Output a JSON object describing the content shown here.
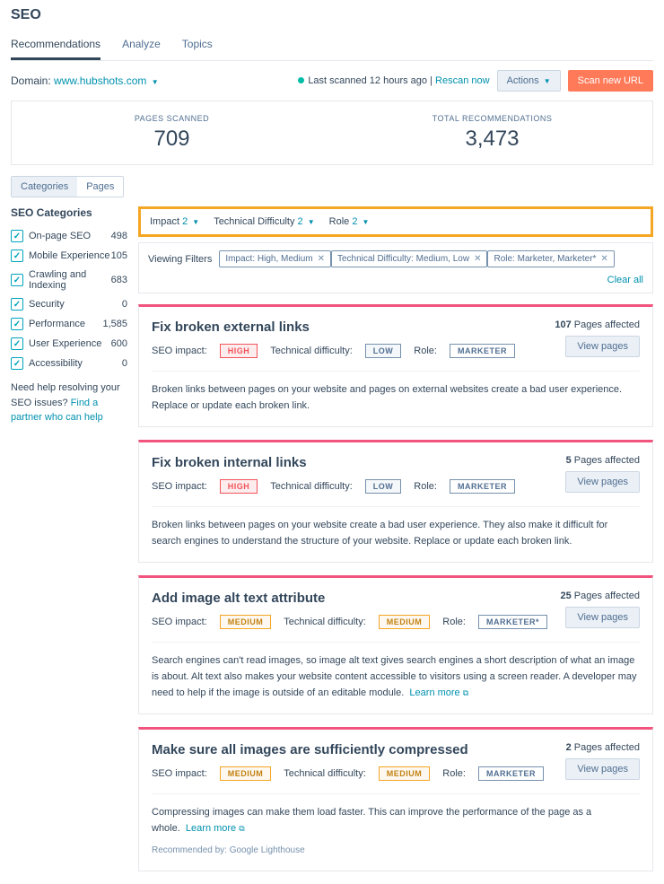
{
  "title": "SEO",
  "tabs": [
    "Recommendations",
    "Analyze",
    "Topics"
  ],
  "domain_label": "Domain:",
  "domain": "www.hubshots.com",
  "scan_status": "Last scanned 12 hours ago",
  "rescan": "Rescan now",
  "actions_btn": "Actions",
  "scan_btn": "Scan new URL",
  "stats": {
    "pages_label": "PAGES SCANNED",
    "pages_value": "709",
    "recs_label": "TOTAL RECOMMENDATIONS",
    "recs_value": "3,473"
  },
  "toggle": [
    "Categories",
    "Pages"
  ],
  "side_title": "SEO Categories",
  "categories": [
    {
      "label": "On-page SEO",
      "count": "498"
    },
    {
      "label": "Mobile Experience",
      "count": "105"
    },
    {
      "label": "Crawling and Indexing",
      "count": "683"
    },
    {
      "label": "Security",
      "count": "0"
    },
    {
      "label": "Performance",
      "count": "1,585"
    },
    {
      "label": "User Experience",
      "count": "600"
    },
    {
      "label": "Accessibility",
      "count": "0"
    }
  ],
  "help_text": "Need help resolving your SEO issues?",
  "help_link": "Find a partner who can help",
  "filters": [
    {
      "label": "Impact",
      "count": "2"
    },
    {
      "label": "Technical Difficulty",
      "count": "2"
    },
    {
      "label": "Role",
      "count": "2"
    }
  ],
  "viewing_label": "Viewing Filters",
  "chips": [
    "Impact: High, Medium",
    "Technical Difficulty: Medium, Low",
    "Role: Marketer, Marketer*"
  ],
  "clear_all": "Clear all",
  "impact_label": "SEO impact:",
  "diff_label": "Technical difficulty:",
  "role_label": "Role:",
  "pages_affected_label": "Pages affected",
  "view_pages": "View pages",
  "learn_more": "Learn more",
  "recs": [
    {
      "title": "Fix broken external links",
      "impact": "HIGH",
      "impact_cls": "high",
      "difficulty": "LOW",
      "diff_cls": "low",
      "role": "MARKETER",
      "pages": "107",
      "desc": "Broken links between pages on your website and pages on external websites create a bad user experience. Replace or update each broken link.",
      "learn": false
    },
    {
      "title": "Fix broken internal links",
      "impact": "HIGH",
      "impact_cls": "high",
      "difficulty": "LOW",
      "diff_cls": "low",
      "role": "MARKETER",
      "pages": "5",
      "desc": "Broken links between pages on your website create a bad user experience. They also make it difficult for search engines to understand the structure of your website. Replace or update each broken link.",
      "learn": false
    },
    {
      "title": "Add image alt text attribute",
      "impact": "MEDIUM",
      "impact_cls": "medium",
      "difficulty": "MEDIUM",
      "diff_cls": "medium",
      "role": "MARKETER*",
      "pages": "25",
      "desc": "Search engines can't read images, so image alt text gives search engines a short description of what an image is about. Alt text also makes your website content accessible to visitors using a screen reader. A developer may need to help if the image is outside of an editable module.",
      "learn": true
    },
    {
      "title": "Make sure all images are sufficiently compressed",
      "impact": "MEDIUM",
      "impact_cls": "medium",
      "difficulty": "MEDIUM",
      "diff_cls": "medium",
      "role": "MARKETER",
      "pages": "2",
      "desc": "Compressing images can make them load faster. This can improve the performance of the page as a whole.",
      "learn": true,
      "recommended_by": "Recommended by: Google Lighthouse"
    }
  ]
}
